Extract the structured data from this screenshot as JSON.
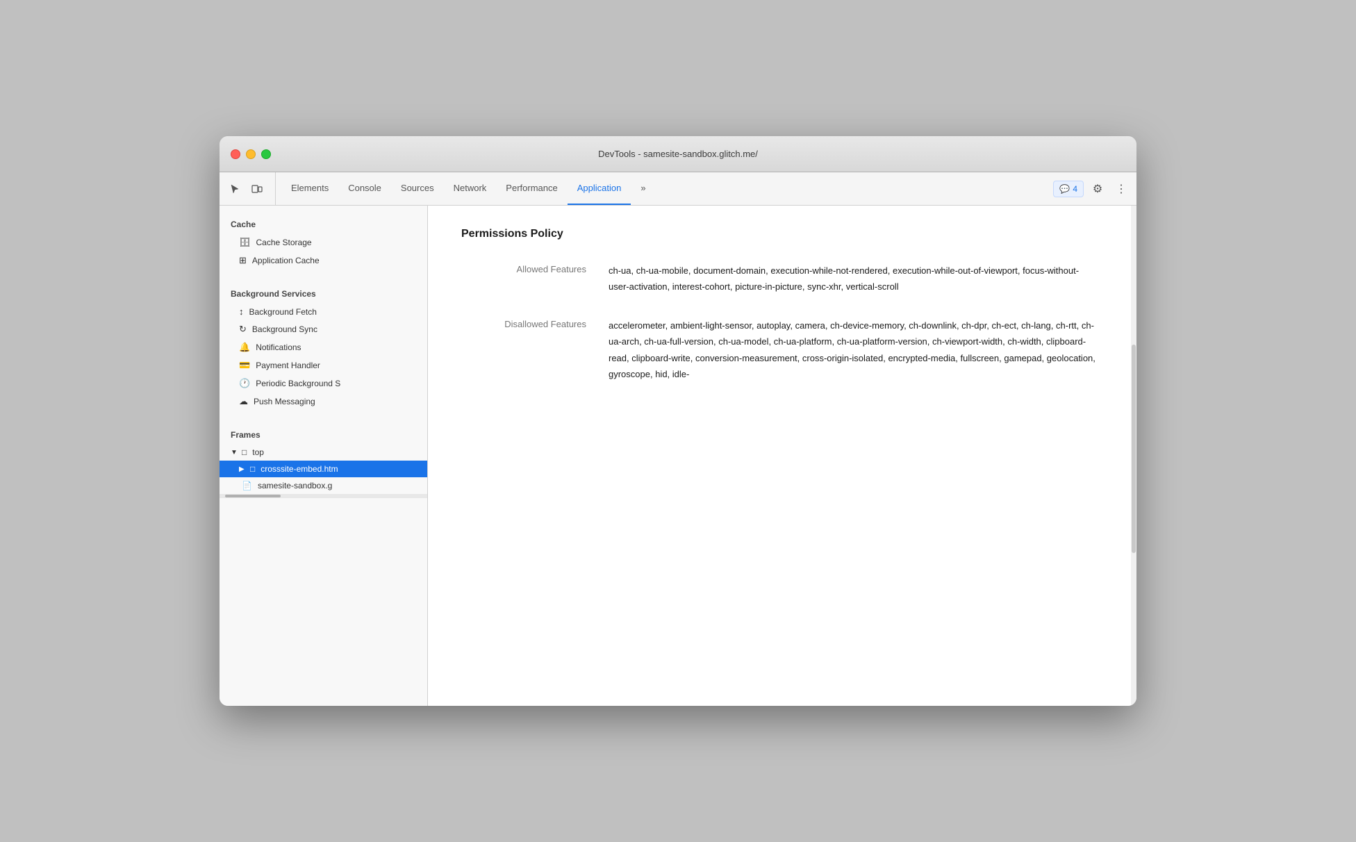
{
  "window": {
    "title": "DevTools - samesite-sandbox.glitch.me/"
  },
  "toolbar": {
    "tabs": [
      {
        "id": "elements",
        "label": "Elements",
        "active": false
      },
      {
        "id": "console",
        "label": "Console",
        "active": false
      },
      {
        "id": "sources",
        "label": "Sources",
        "active": false
      },
      {
        "id": "network",
        "label": "Network",
        "active": false
      },
      {
        "id": "performance",
        "label": "Performance",
        "active": false
      },
      {
        "id": "application",
        "label": "Application",
        "active": true
      }
    ],
    "more_tabs": "»",
    "badge_icon": "💬",
    "badge_count": "4",
    "settings_icon": "⚙",
    "more_icon": "⋮"
  },
  "sidebar": {
    "cache_section": "Cache",
    "cache_storage_label": "Cache Storage",
    "application_cache_label": "Application Cache",
    "background_services_section": "Background Services",
    "background_fetch_label": "Background Fetch",
    "background_sync_label": "Background Sync",
    "notifications_label": "Notifications",
    "payment_handler_label": "Payment Handler",
    "periodic_background_label": "Periodic Background S",
    "push_messaging_label": "Push Messaging",
    "frames_section": "Frames",
    "top_label": "top",
    "crosssite_label": "crosssite-embed.htm",
    "samesite_label": "samesite-sandbox.g"
  },
  "main": {
    "permissions_policy_title": "Permissions Policy",
    "allowed_features_label": "Allowed Features",
    "allowed_features_value": "ch-ua, ch-ua-mobile, document-domain, execution-while-not-rendered, execution-while-out-of-viewport, focus-without-user-activation, interest-cohort, picture-in-picture, sync-xhr, vertical-scroll",
    "disallowed_features_label": "Disallowed Features",
    "disallowed_features_value": "accelerometer, ambient-light-sensor, autoplay, camera, ch-device-memory, ch-downlink, ch-dpr, ch-ect, ch-lang, ch-rtt, ch-ua-arch, ch-ua-full-version, ch-ua-model, ch-ua-platform, ch-ua-platform-version, ch-viewport-width, ch-width, clipboard-read, clipboard-write, conversion-measurement, cross-origin-isolated, encrypted-media, fullscreen, gamepad, geolocation, gyroscope, hid, idle-"
  }
}
